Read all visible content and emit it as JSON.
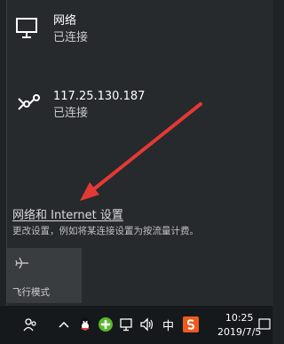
{
  "networks": [
    {
      "name": "网络",
      "status": "已连接",
      "icon": "ethernet-monitor-icon"
    },
    {
      "name": "117.25.130.187",
      "status": "已连接",
      "icon": "dialup-connection-icon"
    }
  ],
  "settings": {
    "link_label": "网络和 Internet 设置",
    "description": "更改设置，例如将某连接设置为按流量计费。"
  },
  "quick_actions": [
    {
      "label": "飞行模式",
      "icon": "airplane-icon"
    }
  ],
  "taskbar": {
    "ime_label": "中",
    "time": "10:25",
    "date": "2019/7/5",
    "tray_icons": [
      "people-icon",
      "chevron-up-icon",
      "qq-penguin-icon",
      "green-shield-icon",
      "network-icon",
      "volume-icon",
      "sogou-ime-icon",
      "notification-icon"
    ]
  },
  "colors": {
    "flyout_bg": "#262a2d",
    "taskbar_bg": "#16191b",
    "annotation_arrow": "#e53935",
    "sogou_orange": "#f05a1e"
  }
}
